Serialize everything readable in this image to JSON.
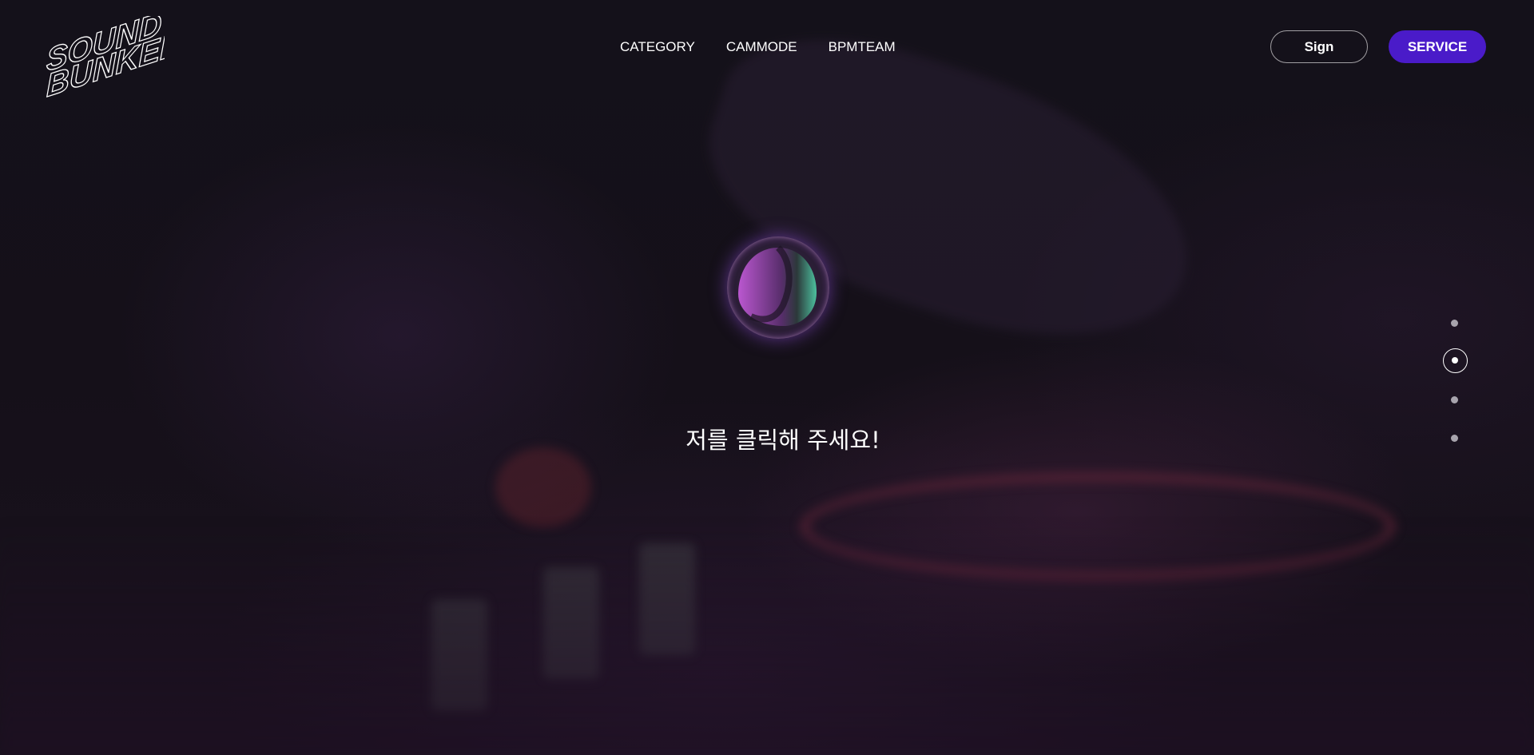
{
  "brand": {
    "logo_line1": "SOUND",
    "logo_line2": "BUNKER"
  },
  "nav": {
    "items": [
      {
        "label": "CATEGORY"
      },
      {
        "label": "CAMMODE"
      },
      {
        "label": "BPMTEAM"
      }
    ]
  },
  "header": {
    "sign_label": "Sign",
    "service_label": "SERVICE"
  },
  "hero": {
    "prompt": "저를 클릭해 주세요!"
  },
  "pagination": {
    "total": 4,
    "active_index": 1
  },
  "colors": {
    "service_button": "#4a1bc9",
    "orb_glow": "#9a50e6",
    "orb_pink": "#c25ad8",
    "orb_teal": "#4fc9a4"
  }
}
